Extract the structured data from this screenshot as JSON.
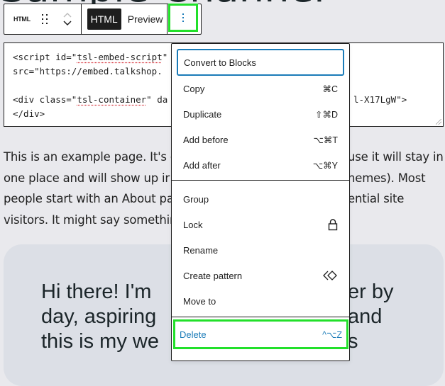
{
  "page": {
    "title_fragment": "Sample Channel"
  },
  "toolbar": {
    "block_type_label": "HTML",
    "mode_html_label": "HTML",
    "mode_preview_label": "Preview",
    "more_options_icon": "kebab-vertical-icon",
    "drag_icon": "drag-handle-icon",
    "move_up_icon": "chevron-up-icon",
    "move_down_icon": "chevron-down-icon"
  },
  "code": {
    "line1_prefix": "<script id=\"",
    "line1_id": "tsl-embed-script",
    "line1_suffix": "\"",
    "line2": "src=\"https://embed.talkshop.",
    "line4_prefix": "<div class=\"",
    "line4_class": "tsl-container",
    "line4_mid": "\" da",
    "line4_tail": "l-X17LgW\">",
    "line5": "</div>"
  },
  "paragraph": {
    "lines": [
      {
        "left": "This is an example page. It's c",
        "right": "use it will stay in"
      },
      {
        "left": "one place and will show up ir",
        "right": "hemes). Most"
      },
      {
        "left": "people start with an About pa",
        "right": "ential site"
      },
      {
        "left": "visitors. It might say somethin",
        "right": ""
      }
    ]
  },
  "card": {
    "lines": [
      {
        "left": "Hi there! I'm",
        "right": "er by"
      },
      {
        "left": "day, aspiring",
        "right": "and"
      },
      {
        "left": "this is my we",
        "right": "s"
      }
    ]
  },
  "menu": {
    "sections": [
      {
        "items": [
          {
            "label": "Convert to Blocks",
            "shortcut": "",
            "state": "focused"
          },
          {
            "label": "Copy",
            "shortcut": "⌘C"
          },
          {
            "label": "Duplicate",
            "shortcut": "⇧⌘D"
          },
          {
            "label": "Add before",
            "shortcut": "⌥⌘T"
          },
          {
            "label": "Add after",
            "shortcut": "⌥⌘Y"
          }
        ]
      },
      {
        "items": [
          {
            "label": "Group",
            "shortcut": ""
          },
          {
            "label": "Lock",
            "icon": "lock-icon"
          },
          {
            "label": "Rename",
            "shortcut": ""
          },
          {
            "label": "Create pattern",
            "icon": "pattern-icon"
          },
          {
            "label": "Move to",
            "shortcut": ""
          }
        ]
      },
      {
        "items": [
          {
            "label": "Delete",
            "shortcut": "^⌥Z",
            "state": "danger"
          }
        ]
      }
    ]
  },
  "colors": {
    "accent": "#1a7bb8",
    "highlight": "#22e02a",
    "page_bg": "#e9e9ed",
    "card_bg": "#dcdfe6"
  }
}
